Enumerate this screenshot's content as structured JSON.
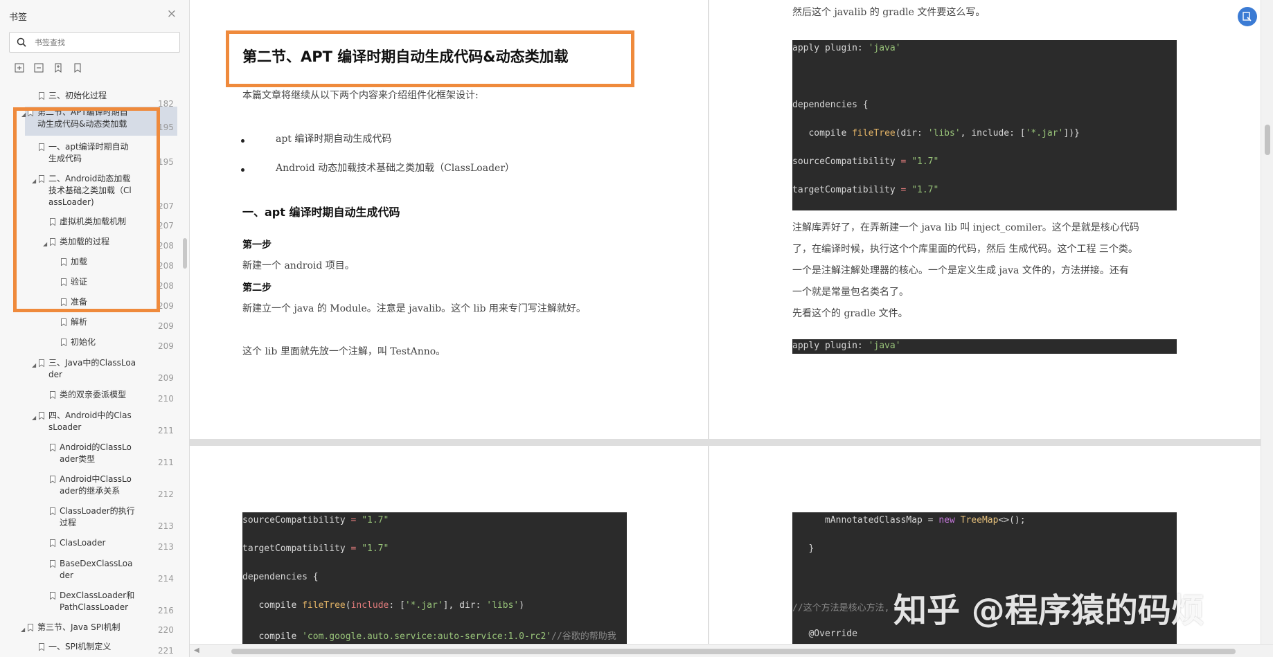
{
  "sidebar": {
    "title": "书签",
    "close_icon": "×",
    "search_placeholder": "书签查找",
    "items": [
      {
        "label": "三、初始化过程",
        "page": "182"
      },
      {
        "label": "第二节、APT编译时期自",
        "label2": "动生成代码&动态类加载",
        "page": "195"
      },
      {
        "label": "一、apt编译时期自动",
        "label2": "生成代码",
        "page": "195"
      },
      {
        "label": "二、Android动态加载",
        "label2": "技术基础之类加载（Cl",
        "label3": "assLoader)",
        "page": "207"
      },
      {
        "label": "虚拟机类加载机制",
        "page": "207"
      },
      {
        "label": "类加载的过程",
        "page": "208"
      },
      {
        "label": "加载",
        "page": "208"
      },
      {
        "label": "验证",
        "page": "208"
      },
      {
        "label": "准备",
        "page": "209"
      },
      {
        "label": "解析",
        "page": "209"
      },
      {
        "label": "初始化",
        "page": "209"
      },
      {
        "label": "三、Java中的ClassLoa",
        "label2": "der",
        "page": "209"
      },
      {
        "label": "类的双亲委派模型",
        "page": "210"
      },
      {
        "label": "四、Android中的Clas",
        "label2": "sLoader",
        "page": "211"
      },
      {
        "label": "Android的ClassLo",
        "label2": "ader类型",
        "page": "211"
      },
      {
        "label": "Android中ClassLo",
        "label2": "ader的继承关系",
        "page": "212"
      },
      {
        "label": "ClassLoader的执行",
        "label2": "过程",
        "page": "213"
      },
      {
        "label": "ClasLoader",
        "page": "213"
      },
      {
        "label": "BaseDexClassLoa",
        "label2": "der",
        "page": "214"
      },
      {
        "label": "DexClassLoader和",
        "label2": "PathClassLoader",
        "page": "216"
      },
      {
        "label": "第三节、Java SPI机制",
        "page": "220"
      },
      {
        "label": "一、SPI机制定义",
        "page": "221"
      }
    ]
  },
  "page1": {
    "title": "第二节、APT 编译时期自动生成代码&动态类加载",
    "intro": "本篇文章将继续从以下两个内容来介绍组件化框架设计:",
    "bullets": [
      "apt 编译时期自动生成代码",
      "Android 动态加载技术基础之类加载（ClassLoader）"
    ],
    "heading1": "一、apt 编译时期自动生成代码",
    "step1": "第一步",
    "step1_text": "新建一个 android 项目。",
    "step2": "第二步",
    "step2_text": "新建立一个 java 的 Module。注意是 javalib。这个 lib 用来专门写注解就好。",
    "para": "这个 lib 里面就先放一个注解，叫 TestAnno。"
  },
  "page2": {
    "top_text": "然后这个 javalib 的 gradle 文件要这么写。",
    "para_lines": [
      "注解库弄好了，在弄新建一个 java lib 叫 inject_comiler。这个是就是核心代码",
      "了，在编译时候，执行这个个库里面的代码，然后 生成代码。这个工程 三个类。",
      "一个是注解注解处理器的核心。一个是定义生成 java 文件的，方法拼接。还有",
      "一个就是常量包名类名了。",
      "先看这个的 gradle 文件。"
    ]
  },
  "code": {
    "apply_plugin": "apply plugin:",
    "java_str": "'java'",
    "dependencies": "dependencies {",
    "compile": "compile",
    "fileTree": "fileTree",
    "args1_a": "(dir:",
    "libs_str": "'libs'",
    "args1_b": ", include: [",
    "jar_str": "'*.jar'",
    "args1_c": "])}",
    "sourceCompat": "sourceCompatibility",
    "targetCompat": "targetCompatibility",
    "eq": "=",
    "ver_str": "\"1.7\"",
    "args2_a": "(",
    "include_kw": "include",
    "args2_b": ": [",
    "args2_c": "], dir:",
    "args2_d": ")",
    "auto_service_str": "'com.google.auto.service:auto-service:1.0-rc2'",
    "auto_comment": "//谷歌的帮助我",
    "map_assign": "mAnnotatedClassMap =",
    "new_kw": "new",
    "treemap": "TreeMap",
    "treemap_tail": "<>();",
    "close_brace": "}",
    "core_comment": "//这个方法是核心方法,",
    "override": "@Override"
  },
  "watermark": "知乎 @程序猿的码烦",
  "colors": {
    "accent": "#ef8a3c",
    "code_bg": "#2b2b2b",
    "string": "#98c379",
    "operator": "#e07b7b",
    "function": "#e5b567",
    "fab": "#3b7bd4"
  }
}
